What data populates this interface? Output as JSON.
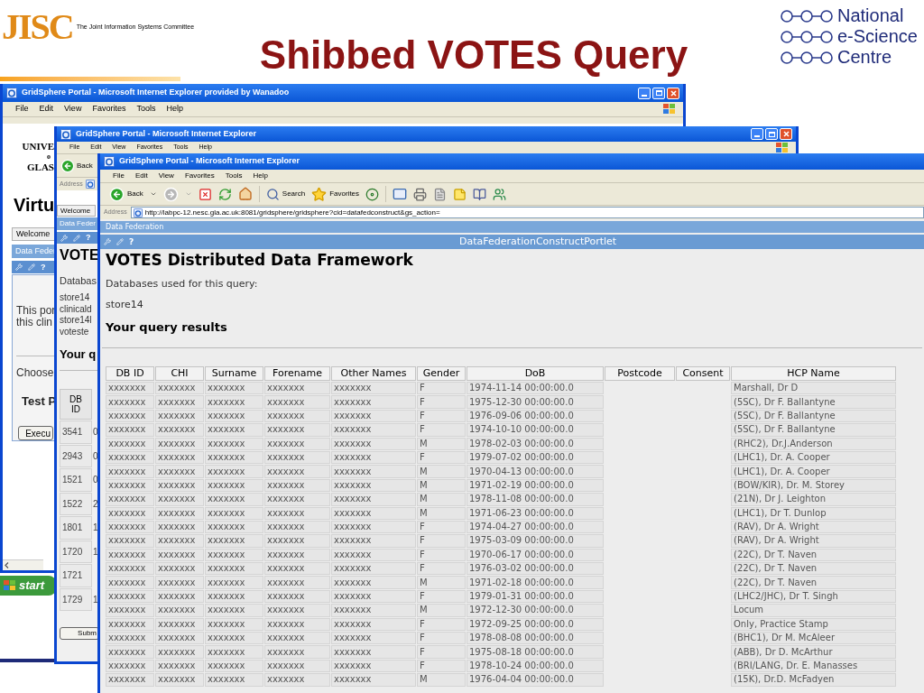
{
  "slide": {
    "title": "Shibbed VOTES Query",
    "left_logo": {
      "mark": "JISC",
      "caption": "The Joint Information Systems Committee"
    },
    "right_logo": {
      "lines": [
        "National",
        "e-Science",
        "Centre"
      ]
    }
  },
  "back_window": {
    "title": "GridSphere Portal - Microsoft Internet Explorer provided by Wanadoo",
    "menu": [
      "File",
      "Edit",
      "View",
      "Favorites",
      "Tools",
      "Help"
    ],
    "page": {
      "header_lines": [
        "UNIVE",
        "o",
        "GLAS"
      ],
      "site_title": "Virtu",
      "tab": "Welcome",
      "portlet_bar": "Data Feder",
      "help": "?",
      "text_lines": [
        "This por",
        "this clin"
      ],
      "label": "Choose",
      "bold_label": "Test P",
      "button": "Execu"
    }
  },
  "taskbar": {
    "start": "start"
  },
  "middle_window": {
    "title": "GridSphere Portal - Microsoft Internet Explorer",
    "menu": [
      "File",
      "Edit",
      "View",
      "Favorites",
      "Tools",
      "Help"
    ],
    "back": "Back",
    "address_label": "Address",
    "page": {
      "tab": "Welcome",
      "portlet_bar": "Data Feder",
      "help": "?",
      "heading": "VOTE",
      "intro": "Databas",
      "databases": [
        "store14",
        "clinicald",
        "store14l",
        "voteste"
      ],
      "results_heading": "Your q",
      "table": {
        "columns": [
          "DB ID"
        ],
        "rows": [
          {
            "db_id": "3541",
            "column_2": "0"
          },
          {
            "db_id": "2943",
            "column_2": "0"
          },
          {
            "db_id": "1521",
            "column_2": "0"
          },
          {
            "db_id": "1522",
            "column_2": "2"
          },
          {
            "db_id": "1801",
            "column_2": "1"
          },
          {
            "db_id": "1720",
            "column_2": "1"
          },
          {
            "db_id": "1721"
          },
          {
            "db_id": "1729",
            "column_2": "1"
          }
        ]
      },
      "button": "Subm"
    }
  },
  "front_window": {
    "title": "GridSphere Portal - Microsoft Internet Explorer",
    "menu": [
      "File",
      "Edit",
      "View",
      "Favorites",
      "Tools",
      "Help"
    ],
    "toolbar": {
      "back": "Back",
      "search": "Search",
      "favorites": "Favorites"
    },
    "address": {
      "label": "Address",
      "url": "http://labpc-12.nesc.gla.ac.uk:8081/gridsphere/gridsphere?cid=datafedconstruct&gs_action="
    },
    "page": {
      "tab_bar": "Data Federation",
      "help": "?",
      "portlet_title": "DataFederationConstructPortlet",
      "heading": "VOTES Distributed Data Framework",
      "intro": "Databases used for this query:",
      "database": "store14",
      "results_heading": "Your query results",
      "table": {
        "columns": [
          "DB ID",
          "CHI",
          "Surname",
          "Forename",
          "Other Names",
          "Gender",
          "DoB",
          "Postcode",
          "Consent",
          "HCP Name"
        ],
        "rows": [
          {
            "db_id": "xxxxxxx",
            "chi": "xxxxxxx",
            "surname": "xxxxxxx",
            "forename": "xxxxxxx",
            "other_names": "xxxxxxx",
            "gender": "F",
            "dob": "1974-11-14 00:00:00.0",
            "hcp_name": "Marshall, Dr D"
          },
          {
            "db_id": "xxxxxxx",
            "chi": "xxxxxxx",
            "surname": "xxxxxxx",
            "forename": "xxxxxxx",
            "other_names": "xxxxxxx",
            "gender": "F",
            "dob": "1975-12-30 00:00:00.0",
            "hcp_name": "(5SC), Dr F. Ballantyne"
          },
          {
            "db_id": "xxxxxxx",
            "chi": "xxxxxxx",
            "surname": "xxxxxxx",
            "forename": "xxxxxxx",
            "other_names": "xxxxxxx",
            "gender": "F",
            "dob": "1976-09-06 00:00:00.0",
            "hcp_name": "(5SC), Dr F. Ballantyne"
          },
          {
            "db_id": "xxxxxxx",
            "chi": "xxxxxxx",
            "surname": "xxxxxxx",
            "forename": "xxxxxxx",
            "other_names": "xxxxxxx",
            "gender": "F",
            "dob": "1974-10-10 00:00:00.0",
            "hcp_name": "(5SC), Dr F. Ballantyne"
          },
          {
            "db_id": "xxxxxxx",
            "chi": "xxxxxxx",
            "surname": "xxxxxxx",
            "forename": "xxxxxxx",
            "other_names": "xxxxxxx",
            "gender": "M",
            "dob": "1978-02-03 00:00:00.0",
            "hcp_name": "(RHC2), Dr.J.Anderson"
          },
          {
            "db_id": "xxxxxxx",
            "chi": "xxxxxxx",
            "surname": "xxxxxxx",
            "forename": "xxxxxxx",
            "other_names": "xxxxxxx",
            "gender": "F",
            "dob": "1979-07-02 00:00:00.0",
            "hcp_name": "(LHC1), Dr. A. Cooper"
          },
          {
            "db_id": "xxxxxxx",
            "chi": "xxxxxxx",
            "surname": "xxxxxxx",
            "forename": "xxxxxxx",
            "other_names": "xxxxxxx",
            "gender": "M",
            "dob": "1970-04-13 00:00:00.0",
            "hcp_name": "(LHC1), Dr. A. Cooper"
          },
          {
            "db_id": "xxxxxxx",
            "chi": "xxxxxxx",
            "surname": "xxxxxxx",
            "forename": "xxxxxxx",
            "other_names": "xxxxxxx",
            "gender": "M",
            "dob": "1971-02-19 00:00:00.0",
            "hcp_name": "(BOW/KIR), Dr. M. Storey"
          },
          {
            "db_id": "xxxxxxx",
            "chi": "xxxxxxx",
            "surname": "xxxxxxx",
            "forename": "xxxxxxx",
            "other_names": "xxxxxxx",
            "gender": "M",
            "dob": "1978-11-08 00:00:00.0",
            "hcp_name": "(21N), Dr J. Leighton"
          },
          {
            "db_id": "xxxxxxx",
            "chi": "xxxxxxx",
            "surname": "xxxxxxx",
            "forename": "xxxxxxx",
            "other_names": "xxxxxxx",
            "gender": "M",
            "dob": "1971-06-23 00:00:00.0",
            "hcp_name": "(LHC1), Dr T. Dunlop"
          },
          {
            "db_id": "xxxxxxx",
            "chi": "xxxxxxx",
            "surname": "xxxxxxx",
            "forename": "xxxxxxx",
            "other_names": "xxxxxxx",
            "gender": "F",
            "dob": "1974-04-27 00:00:00.0",
            "hcp_name": "(RAV), Dr A. Wright"
          },
          {
            "db_id": "xxxxxxx",
            "chi": "xxxxxxx",
            "surname": "xxxxxxx",
            "forename": "xxxxxxx",
            "other_names": "xxxxxxx",
            "gender": "F",
            "dob": "1975-03-09 00:00:00.0",
            "hcp_name": "(RAV), Dr A. Wright"
          },
          {
            "db_id": "xxxxxxx",
            "chi": "xxxxxxx",
            "surname": "xxxxxxx",
            "forename": "xxxxxxx",
            "other_names": "xxxxxxx",
            "gender": "F",
            "dob": "1970-06-17 00:00:00.0",
            "hcp_name": "(22C), Dr T. Naven"
          },
          {
            "db_id": "xxxxxxx",
            "chi": "xxxxxxx",
            "surname": "xxxxxxx",
            "forename": "xxxxxxx",
            "other_names": "xxxxxxx",
            "gender": "F",
            "dob": "1976-03-02 00:00:00.0",
            "hcp_name": "(22C), Dr T. Naven"
          },
          {
            "db_id": "xxxxxxx",
            "chi": "xxxxxxx",
            "surname": "xxxxxxx",
            "forename": "xxxxxxx",
            "other_names": "xxxxxxx",
            "gender": "M",
            "dob": "1971-02-18 00:00:00.0",
            "hcp_name": "(22C), Dr T. Naven"
          },
          {
            "db_id": "xxxxxxx",
            "chi": "xxxxxxx",
            "surname": "xxxxxxx",
            "forename": "xxxxxxx",
            "other_names": "xxxxxxx",
            "gender": "F",
            "dob": "1979-01-31 00:00:00.0",
            "hcp_name": "(LHC2/JHC), Dr T. Singh"
          },
          {
            "db_id": "xxxxxxx",
            "chi": "xxxxxxx",
            "surname": "xxxxxxx",
            "forename": "xxxxxxx",
            "other_names": "xxxxxxx",
            "gender": "M",
            "dob": "1972-12-30 00:00:00.0",
            "hcp_name": "Locum"
          },
          {
            "db_id": "xxxxxxx",
            "chi": "xxxxxxx",
            "surname": "xxxxxxx",
            "forename": "xxxxxxx",
            "other_names": "xxxxxxx",
            "gender": "F",
            "dob": "1972-09-25 00:00:00.0",
            "hcp_name": "Only, Practice Stamp"
          },
          {
            "db_id": "xxxxxxx",
            "chi": "xxxxxxx",
            "surname": "xxxxxxx",
            "forename": "xxxxxxx",
            "other_names": "xxxxxxx",
            "gender": "F",
            "dob": "1978-08-08 00:00:00.0",
            "hcp_name": "(BHC1), Dr M. McAleer"
          },
          {
            "db_id": "xxxxxxx",
            "chi": "xxxxxxx",
            "surname": "xxxxxxx",
            "forename": "xxxxxxx",
            "other_names": "xxxxxxx",
            "gender": "F",
            "dob": "1975-08-18 00:00:00.0",
            "hcp_name": "(ABB), Dr D. McArthur"
          },
          {
            "db_id": "xxxxxxx",
            "chi": "xxxxxxx",
            "surname": "xxxxxxx",
            "forename": "xxxxxxx",
            "other_names": "xxxxxxx",
            "gender": "F",
            "dob": "1978-10-24 00:00:00.0",
            "hcp_name": "(BRI/LANG, Dr. E. Manasses"
          },
          {
            "db_id": "xxxxxxx",
            "chi": "xxxxxxx",
            "surname": "xxxxxxx",
            "forename": "xxxxxxx",
            "other_names": "xxxxxxx",
            "gender": "M",
            "dob": "1976-04-04 00:00:00.0",
            "hcp_name": "(15K), Dr.D. McFadyen"
          }
        ]
      }
    }
  }
}
